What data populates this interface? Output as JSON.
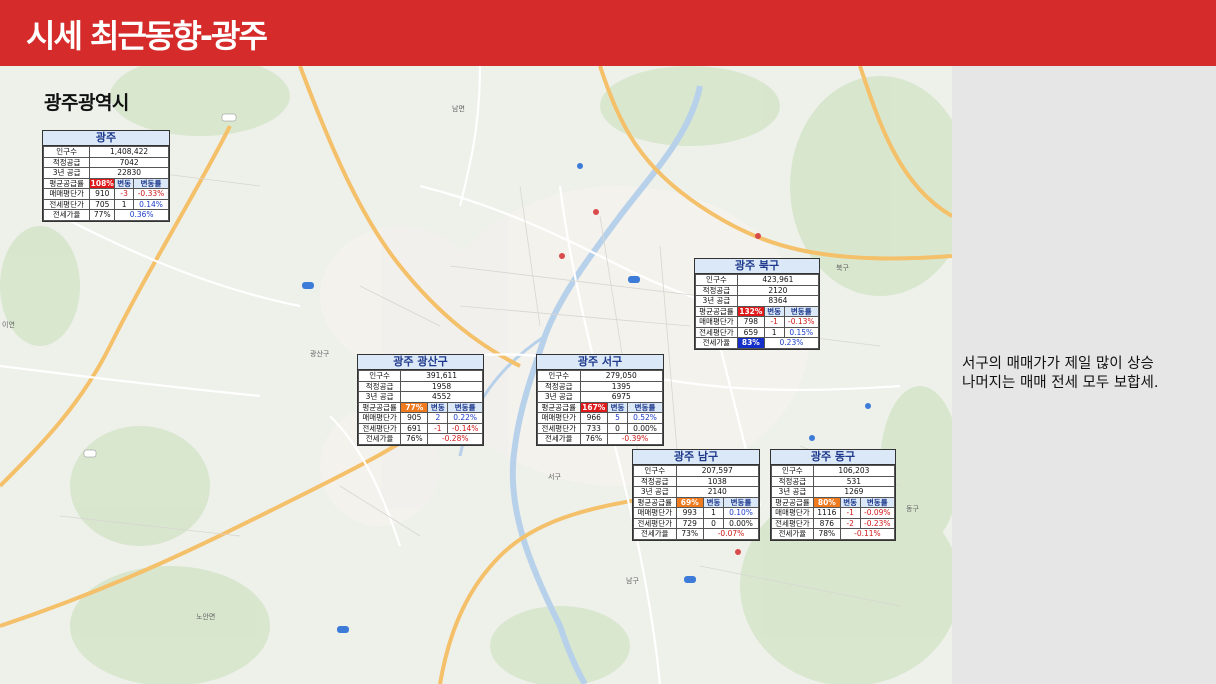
{
  "header": {
    "title": "시세 최근동향-광주"
  },
  "map": {
    "region_title": "광주광역시",
    "labels": [
      {
        "id": "nam-myeon",
        "text": "남면"
      },
      {
        "id": "gwangsan",
        "text": "광산구"
      },
      {
        "id": "seo",
        "text": "서구"
      },
      {
        "id": "nam",
        "text": "남구"
      },
      {
        "id": "dong",
        "text": "동구"
      },
      {
        "id": "buk",
        "text": "북구"
      },
      {
        "id": "noan",
        "text": "노안면"
      },
      {
        "id": "iyeon",
        "text": "이연"
      }
    ]
  },
  "tables": [
    {
      "id": "gwangju",
      "title": "광주",
      "population_label": "인구수",
      "population": "1,408,422",
      "supply_label": "적정공급",
      "supply": "7042",
      "supply3_label": "3년 공급",
      "supply3": "22830",
      "avg_label": "평균공급률",
      "avg_rate": "108%",
      "avg_color": "#e01a1a",
      "chg_label": "변동",
      "chgpct_label": "변동률",
      "sale_label": "매매평단가",
      "sale": "910",
      "sale_chg": "-3",
      "sale_pct": "-0.33%",
      "jeonse_label": "전세평단가",
      "jeonse": "705",
      "jeonse_chg": "1",
      "jeonse_pct": "0.14%",
      "ratio_label": "전세가율",
      "ratio": "77%",
      "ratio_chg": "0.36%"
    },
    {
      "id": "buk",
      "title": "광주 북구",
      "population_label": "인구수",
      "population": "423,961",
      "supply_label": "적정공급",
      "supply": "2120",
      "supply3_label": "3년 공급",
      "supply3": "8364",
      "avg_label": "평균공급률",
      "avg_rate": "132%",
      "avg_color": "#e01a1a",
      "chg_label": "변동",
      "chgpct_label": "변동률",
      "sale_label": "매매평단가",
      "sale": "798",
      "sale_chg": "-1",
      "sale_pct": "-0.13%",
      "jeonse_label": "전세평단가",
      "jeonse": "659",
      "jeonse_chg": "1",
      "jeonse_pct": "0.15%",
      "ratio_label": "전세가율",
      "ratio": "83%",
      "ratio_chg": "0.23%",
      "ratio_highlight": "#1530c8"
    },
    {
      "id": "gwangsan",
      "title": "광주 광산구",
      "population_label": "인구수",
      "population": "391,611",
      "supply_label": "적정공급",
      "supply": "1958",
      "supply3_label": "3년 공급",
      "supply3": "4552",
      "avg_label": "평균공급률",
      "avg_rate": "77%",
      "avg_color": "#f07a1e",
      "chg_label": "변동",
      "chgpct_label": "변동률",
      "sale_label": "매매평단가",
      "sale": "905",
      "sale_chg": "2",
      "sale_pct": "0.22%",
      "jeonse_label": "전세평단가",
      "jeonse": "691",
      "jeonse_chg": "-1",
      "jeonse_pct": "-0.14%",
      "ratio_label": "전세가율",
      "ratio": "76%",
      "ratio_chg": "-0.28%"
    },
    {
      "id": "seo",
      "title": "광주 서구",
      "population_label": "인구수",
      "population": "279,050",
      "supply_label": "적정공급",
      "supply": "1395",
      "supply3_label": "3년 공급",
      "supply3": "6975",
      "avg_label": "평균공급률",
      "avg_rate": "167%",
      "avg_color": "#e01a1a",
      "chg_label": "변동",
      "chgpct_label": "변동률",
      "sale_label": "매매평단가",
      "sale": "966",
      "sale_chg": "5",
      "sale_pct": "0.52%",
      "jeonse_label": "전세평단가",
      "jeonse": "733",
      "jeonse_chg": "0",
      "jeonse_pct": "0.00%",
      "ratio_label": "전세가율",
      "ratio": "76%",
      "ratio_chg": "-0.39%"
    },
    {
      "id": "nam",
      "title": "광주 남구",
      "population_label": "인구수",
      "population": "207,597",
      "supply_label": "적정공급",
      "supply": "1038",
      "supply3_label": "3년 공급",
      "supply3": "2140",
      "avg_label": "평균공급률",
      "avg_rate": "69%",
      "avg_color": "#f07a1e",
      "chg_label": "변동",
      "chgpct_label": "변동률",
      "sale_label": "매매평단가",
      "sale": "993",
      "sale_chg": "1",
      "sale_pct": "0.10%",
      "jeonse_label": "전세평단가",
      "jeonse": "729",
      "jeonse_chg": "0",
      "jeonse_pct": "0.00%",
      "ratio_label": "전세가율",
      "ratio": "73%",
      "ratio_chg": "-0.07%"
    },
    {
      "id": "dong",
      "title": "광주 동구",
      "population_label": "인구수",
      "population": "106,203",
      "supply_label": "적정공급",
      "supply": "531",
      "supply3_label": "3년 공급",
      "supply3": "1269",
      "avg_label": "평균공급률",
      "avg_rate": "80%",
      "avg_color": "#f07a1e",
      "chg_label": "변동",
      "chgpct_label": "변동률",
      "sale_label": "매매평단가",
      "sale": "1116",
      "sale_chg": "-1",
      "sale_pct": "-0.09%",
      "jeonse_label": "전세평단가",
      "jeonse": "876",
      "jeonse_chg": "-2",
      "jeonse_pct": "-0.23%",
      "ratio_label": "전세가율",
      "ratio": "78%",
      "ratio_chg": "-0.11%"
    }
  ],
  "note": {
    "line1": "서구의 매매가가 제일 많이 상승",
    "line2": "나머지는 매매 전세 모두 보합세."
  }
}
